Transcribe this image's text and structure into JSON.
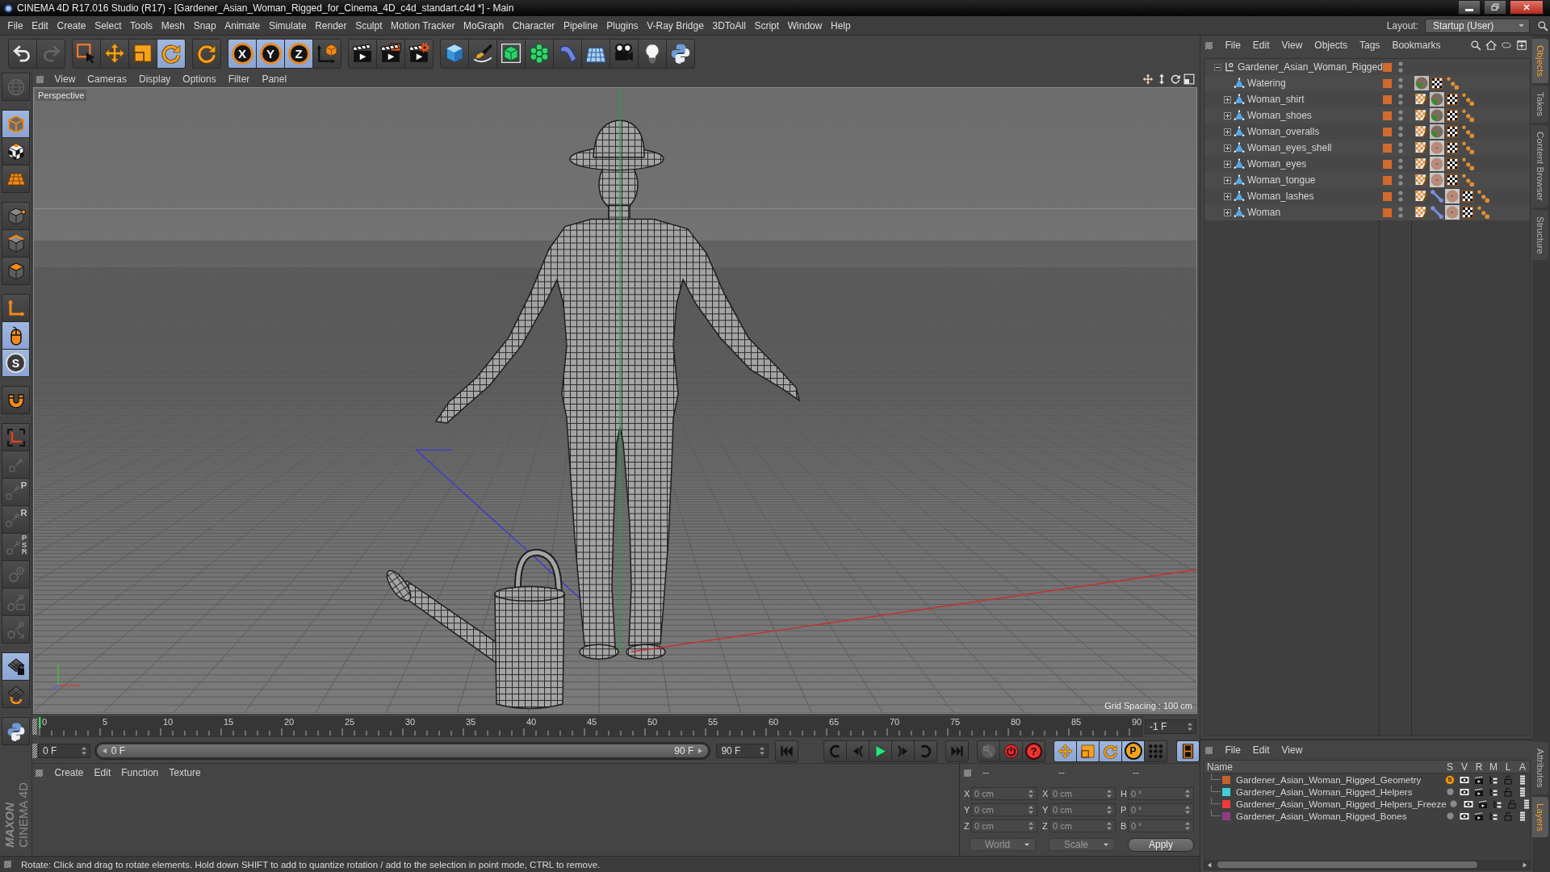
{
  "window": {
    "title": "CINEMA 4D R17.016 Studio (R17) - [Gardener_Asian_Woman_Rigged_for_Cinema_4D_c4d_standart.c4d *] - Main"
  },
  "menu": [
    "File",
    "Edit",
    "Create",
    "Select",
    "Tools",
    "Mesh",
    "Snap",
    "Animate",
    "Simulate",
    "Render",
    "Sculpt",
    "Motion Tracker",
    "MoGraph",
    "Character",
    "Pipeline",
    "Plugins",
    "V-Ray Bridge",
    "3DToAll",
    "Script",
    "Window",
    "Help"
  ],
  "layout": {
    "label": "Layout:",
    "value": "Startup (User)"
  },
  "toolbar": [
    [
      {
        "kind": "undo",
        "active": false,
        "disabled": false
      },
      {
        "kind": "redo",
        "active": false,
        "disabled": true
      }
    ],
    [
      {
        "kind": "select",
        "active": false,
        "disabled": false
      },
      {
        "kind": "move",
        "active": false,
        "disabled": false
      },
      {
        "kind": "scale",
        "active": false,
        "disabled": false
      },
      {
        "kind": "rotate",
        "active": true,
        "disabled": false
      }
    ],
    [
      {
        "kind": "recent",
        "active": false,
        "disabled": false
      }
    ],
    [
      {
        "kind": "axis",
        "label": "X",
        "active": true,
        "disabled": false
      },
      {
        "kind": "axis",
        "label": "Y",
        "active": true,
        "disabled": false
      },
      {
        "kind": "axis",
        "label": "Z",
        "active": true,
        "disabled": false
      },
      {
        "kind": "coords",
        "active": false,
        "disabled": false
      }
    ],
    [
      {
        "kind": "renderview",
        "active": false,
        "disabled": false
      },
      {
        "kind": "render",
        "active": false,
        "disabled": false
      },
      {
        "kind": "rendersettings",
        "active": false,
        "disabled": false
      }
    ],
    [
      {
        "kind": "cube",
        "active": false,
        "disabled": false
      },
      {
        "kind": "pen",
        "active": false,
        "disabled": false
      },
      {
        "kind": "subdivision",
        "active": false,
        "disabled": false
      },
      {
        "kind": "cloner",
        "active": false,
        "disabled": false
      },
      {
        "kind": "deformer",
        "active": false,
        "disabled": false
      },
      {
        "kind": "floor",
        "active": false,
        "disabled": false
      },
      {
        "kind": "camera",
        "active": false,
        "disabled": false
      },
      {
        "kind": "light",
        "active": false,
        "disabled": false
      },
      {
        "kind": "python",
        "active": false,
        "disabled": false
      }
    ]
  ],
  "tools": [
    [
      {
        "kind": "globe",
        "active": false,
        "disabled": true
      }
    ],
    [
      {
        "kind": "model",
        "active": true,
        "disabled": false
      },
      {
        "kind": "texture",
        "active": false,
        "disabled": false
      },
      {
        "kind": "workplane",
        "active": false,
        "disabled": false
      }
    ],
    [
      {
        "kind": "points",
        "active": false,
        "disabled": false
      },
      {
        "kind": "edges",
        "active": false,
        "disabled": false
      },
      {
        "kind": "polygons",
        "active": false,
        "disabled": false
      }
    ],
    [
      {
        "kind": "axismode",
        "active": false,
        "disabled": false
      },
      {
        "kind": "tweak",
        "active": true,
        "disabled": false
      },
      {
        "kind": "snap",
        "label": "S",
        "active": true,
        "disabled": false
      }
    ],
    [
      {
        "kind": "magnet",
        "active": false,
        "disabled": false
      }
    ],
    [
      {
        "kind": "bracket",
        "active": false,
        "disabled": false
      },
      {
        "kind": "joint",
        "active": false,
        "disabled": true
      },
      {
        "kind": "joint",
        "label": "P",
        "active": false,
        "disabled": true
      },
      {
        "kind": "joint",
        "label": "R",
        "active": false,
        "disabled": true
      },
      {
        "kind": "joint",
        "label": "PSR",
        "active": false,
        "disabled": true
      },
      {
        "kind": "ring",
        "active": false,
        "disabled": true
      },
      {
        "kind": "jointbox",
        "active": false,
        "disabled": true
      },
      {
        "kind": "jointarrow",
        "active": false,
        "disabled": true
      }
    ],
    [
      {
        "kind": "gridlock",
        "active": true,
        "disabled": false
      },
      {
        "kind": "gridloop",
        "active": false,
        "disabled": false
      }
    ],
    [
      {
        "kind": "python",
        "active": false,
        "disabled": false
      }
    ]
  ],
  "logo": {
    "brand": "MAXON",
    "product": "CINEMA 4D"
  },
  "viewport": {
    "menu": [
      "View",
      "Cameras",
      "Display",
      "Options",
      "Filter",
      "Panel"
    ],
    "camera": "Perspective",
    "grid_spacing": "Grid Spacing : 100 cm"
  },
  "timeline": {
    "ticks": [
      "0",
      "5",
      "10",
      "15",
      "20",
      "25",
      "30",
      "35",
      "40",
      "45",
      "50",
      "55",
      "60",
      "65",
      "70",
      "75",
      "80",
      "85",
      "90"
    ],
    "current_frame": "-1 F",
    "start": "0 F",
    "range": {
      "start": "0 F",
      "end": "90 F",
      "level": 1
    },
    "end": "90 F"
  },
  "transport": [
    [
      {
        "kind": "first",
        "active": false,
        "disabled": false
      }
    ],
    [
      {
        "kind": "prevkey",
        "active": false,
        "disabled": false
      },
      {
        "kind": "prev",
        "active": false,
        "disabled": false
      },
      {
        "kind": "play",
        "active": false,
        "disabled": false
      },
      {
        "kind": "next",
        "active": false,
        "disabled": false
      },
      {
        "kind": "nextkey",
        "active": false,
        "disabled": false
      }
    ],
    [
      {
        "kind": "last",
        "active": false,
        "disabled": false
      }
    ],
    [
      {
        "kind": "autokey",
        "active": false,
        "disabled": true
      },
      {
        "kind": "record",
        "active": false,
        "disabled": false
      },
      {
        "kind": "help",
        "label": "?",
        "active": false,
        "disabled": false
      }
    ],
    [
      {
        "kind": "keymove",
        "active": true,
        "disabled": false
      },
      {
        "kind": "keyscale",
        "active": true,
        "disabled": false
      },
      {
        "kind": "keyrotate",
        "active": true,
        "disabled": false
      },
      {
        "kind": "keyparam",
        "label": "P",
        "active": true,
        "disabled": false
      },
      {
        "kind": "keypoints",
        "active": false,
        "disabled": false
      }
    ],
    [
      {
        "kind": "timeline",
        "active": true,
        "disabled": false
      }
    ]
  ],
  "materials": {
    "menu": [
      "Create",
      "Edit",
      "Function",
      "Texture"
    ]
  },
  "coordinates": {
    "headers": [
      "--",
      "--",
      "--"
    ],
    "rows": [
      [
        {
          "label": "X",
          "value": "0 cm",
          "disabled": true
        },
        {
          "label": "X",
          "value": "0 cm",
          "disabled": true
        },
        {
          "label": "H",
          "value": "0 °",
          "disabled": true
        }
      ],
      [
        {
          "label": "Y",
          "value": "0 cm",
          "disabled": true
        },
        {
          "label": "Y",
          "value": "0 cm",
          "disabled": true
        },
        {
          "label": "P",
          "value": "0 °",
          "disabled": true
        }
      ],
      [
        {
          "label": "Z",
          "value": "0 cm",
          "disabled": true
        },
        {
          "label": "Z",
          "value": "0 cm",
          "disabled": true
        },
        {
          "label": "B",
          "value": "0 °",
          "disabled": true
        }
      ]
    ],
    "dropdowns": [
      {
        "value": "World",
        "disabled": true
      },
      {
        "value": "Scale",
        "disabled": true
      }
    ],
    "apply": "Apply"
  },
  "status_bar": "Rotate: Click and drag to rotate elements. Hold down SHIFT to add to quantize rotation / add to the selection in point mode, CTRL to remove.",
  "objects": {
    "menu": [
      "File",
      "Edit",
      "View",
      "Objects",
      "Tags",
      "Bookmarks"
    ],
    "tree": [
      {
        "name": "Gardener_Asian_Woman_Rigged",
        "kind": "null",
        "color": "#d3692d",
        "expanded": true,
        "children": [
          {
            "name": "Watering",
            "kind": "polygon",
            "color": "#d3692d",
            "tags": [
              {
                "kind": "material"
              },
              {
                "kind": "uvw"
              },
              {
                "kind": "selection"
              }
            ]
          },
          {
            "name": "Woman_shirt",
            "kind": "polygon",
            "color": "#d3692d",
            "expanded": false,
            "tags": [
              {
                "kind": "weight"
              },
              {
                "kind": "material"
              },
              {
                "kind": "uvw"
              },
              {
                "kind": "selection"
              }
            ]
          },
          {
            "name": "Woman_shoes",
            "kind": "polygon",
            "color": "#d3692d",
            "expanded": false,
            "tags": [
              {
                "kind": "weight"
              },
              {
                "kind": "material"
              },
              {
                "kind": "uvw"
              },
              {
                "kind": "selection"
              }
            ]
          },
          {
            "name": "Woman_overalls",
            "kind": "polygon",
            "color": "#d3692d",
            "expanded": false,
            "tags": [
              {
                "kind": "weight"
              },
              {
                "kind": "material"
              },
              {
                "kind": "uvw"
              },
              {
                "kind": "selection"
              }
            ]
          },
          {
            "name": "Woman_eyes_shell",
            "kind": "polygon",
            "color": "#d3692d",
            "expanded": false,
            "tags": [
              {
                "kind": "weight"
              },
              {
                "kind": "sphere"
              },
              {
                "kind": "uvw"
              },
              {
                "kind": "selection"
              }
            ]
          },
          {
            "name": "Woman_eyes",
            "kind": "polygon",
            "color": "#d3692d",
            "expanded": false,
            "tags": [
              {
                "kind": "weight"
              },
              {
                "kind": "sphere"
              },
              {
                "kind": "uvw"
              },
              {
                "kind": "selection"
              }
            ]
          },
          {
            "name": "Woman_tongue",
            "kind": "polygon",
            "color": "#d3692d",
            "expanded": false,
            "tags": [
              {
                "kind": "weight"
              },
              {
                "kind": "sphere"
              },
              {
                "kind": "uvw"
              },
              {
                "kind": "selection"
              }
            ]
          },
          {
            "name": "Woman_lashes",
            "kind": "polygon",
            "color": "#d3692d",
            "expanded": false,
            "tags": [
              {
                "kind": "weight"
              },
              {
                "kind": "bone"
              },
              {
                "kind": "sphere"
              },
              {
                "kind": "uvw"
              },
              {
                "kind": "selection"
              }
            ]
          },
          {
            "name": "Woman",
            "kind": "polygon",
            "color": "#d3692d",
            "expanded": false,
            "tags": [
              {
                "kind": "weight"
              },
              {
                "kind": "bone"
              },
              {
                "kind": "sphere"
              },
              {
                "kind": "uvw"
              },
              {
                "kind": "selection"
              }
            ]
          }
        ]
      }
    ]
  },
  "layers": {
    "menu": [
      "File",
      "Edit",
      "View"
    ],
    "columns": [
      "Name",
      "S",
      "V",
      "R",
      "M",
      "L",
      "A"
    ],
    "solo_symbol": "S",
    "rows": [
      {
        "name": "Gardener_Asian_Woman_Rigged_Geometry",
        "color": "#c2622e",
        "solo": true
      },
      {
        "name": "Gardener_Asian_Woman_Rigged_Helpers",
        "color": "#3fcfd9",
        "solo": false
      },
      {
        "name": "Gardener_Asian_Woman_Rigged_Helpers_Freeze",
        "color": "#ee3b3b",
        "solo": false
      },
      {
        "name": "Gardener_Asian_Woman_Rigged_Bones",
        "color": "#8e3d84",
        "solo": false
      }
    ]
  },
  "side_tabs": {
    "top": [
      {
        "label": "Objects",
        "selected": true
      },
      {
        "label": "Takes",
        "selected": false
      },
      {
        "label": "Content Browser",
        "selected": false
      },
      {
        "label": "Structure",
        "selected": false
      }
    ],
    "bottom": [
      {
        "label": "Attributes",
        "selected": false
      },
      {
        "label": "Layers",
        "selected": true
      }
    ]
  }
}
